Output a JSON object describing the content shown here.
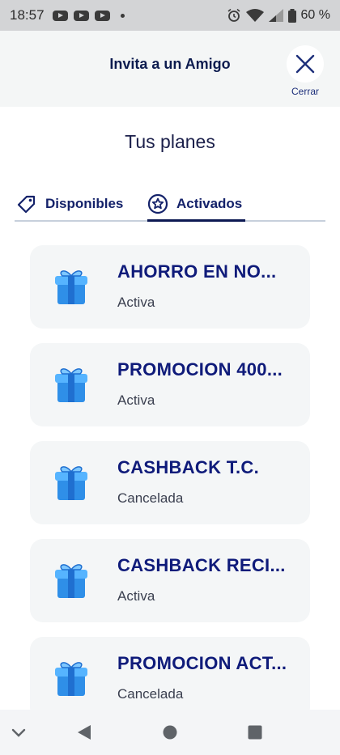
{
  "status_bar": {
    "time": "18:57",
    "battery": "60 %"
  },
  "header": {
    "title": "Invita a un Amigo",
    "close_label": "Cerrar"
  },
  "section_title": "Tus planes",
  "tabs": [
    {
      "label": "Disponibles",
      "icon": "tag-icon",
      "selected": false
    },
    {
      "label": "Activados",
      "icon": "star-badge-icon",
      "selected": true
    }
  ],
  "plans": [
    {
      "title": "AHORRO EN NO...",
      "status": "Activa",
      "icon": "gift-icon"
    },
    {
      "title": "PROMOCION 400...",
      "status": "Activa",
      "icon": "gift-icon"
    },
    {
      "title": "CASHBACK T.C.",
      "status": "Cancelada",
      "icon": "gift-icon"
    },
    {
      "title": "CASHBACK RECI...",
      "status": "Activa",
      "icon": "gift-icon"
    },
    {
      "title": "PROMOCION ACT...",
      "status": "Cancelada",
      "icon": "gift-icon"
    }
  ],
  "colors": {
    "accent": "#0f1b7a",
    "card_bg": "#f4f6f7",
    "gift_blue": "#2f8fe8"
  }
}
